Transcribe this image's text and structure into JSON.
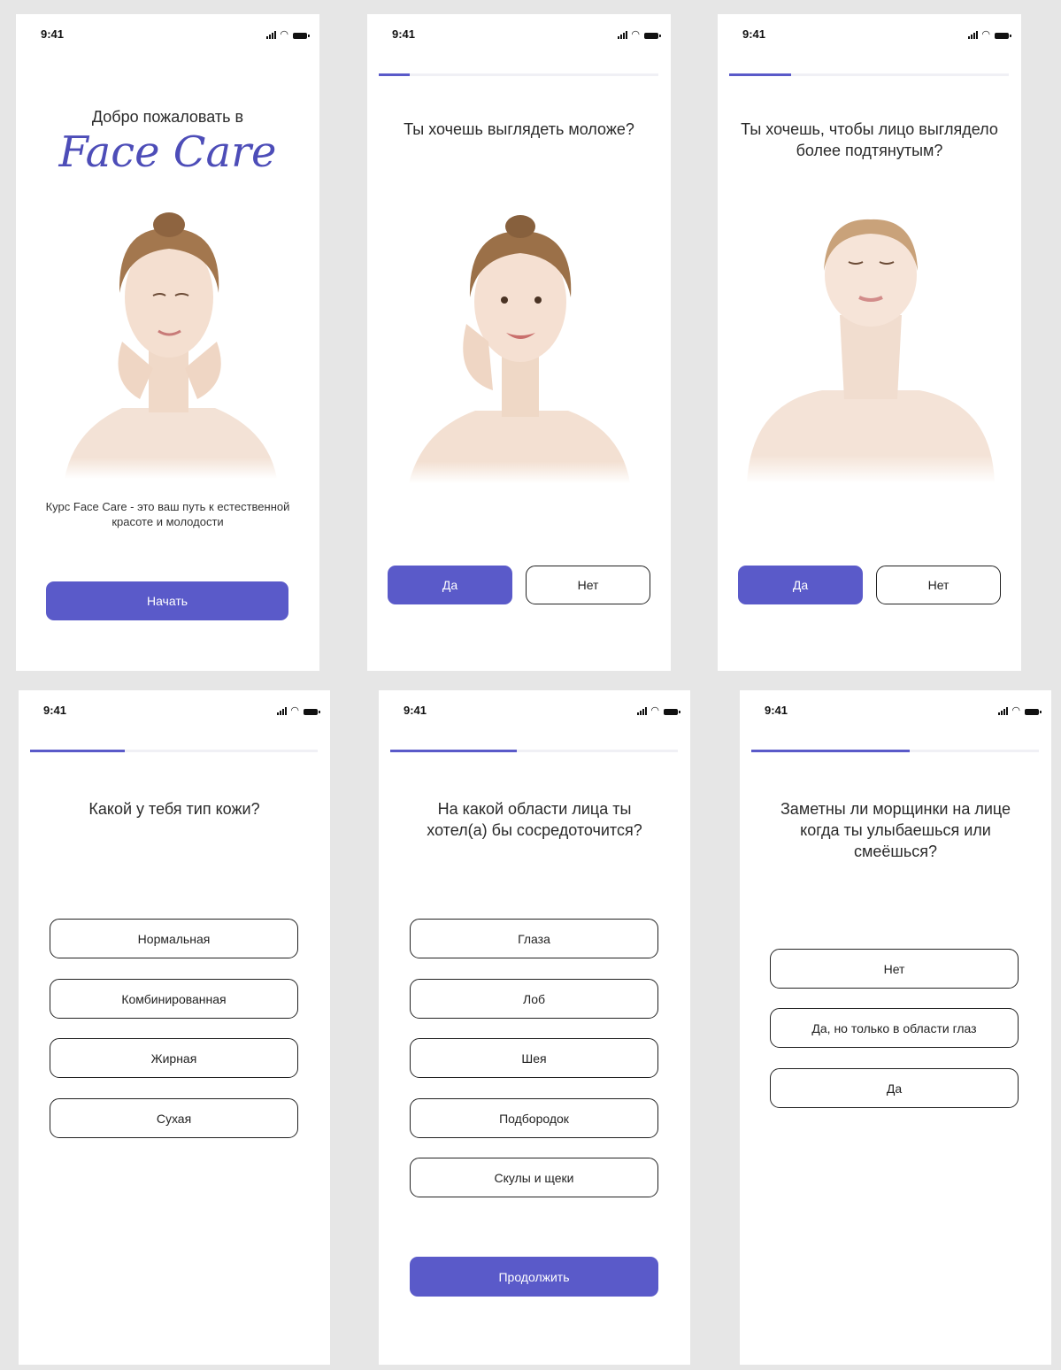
{
  "colors": {
    "accent": "#5a5ac9",
    "brand_text": "#4d4db8",
    "background": "#e6e6e6"
  },
  "status_bar": {
    "time": "9:41"
  },
  "screens": {
    "welcome": {
      "heading": "Добро пожаловать в",
      "brand": "Face Care",
      "description": "Курс Face Care - это ваш путь к естественной красоте и молодости",
      "start_button": "Начать"
    },
    "q_younger": {
      "progress": 0.11,
      "question": "Ты хочешь выглядеть моложе?",
      "yes": "Да",
      "no": "Нет"
    },
    "q_lifted": {
      "progress": 0.22,
      "question": "Ты хочешь, чтобы лицо выглядело более подтянутым?",
      "yes": "Да",
      "no": "Нет"
    },
    "q_skin_type": {
      "progress": 0.33,
      "question": "Какой у тебя тип кожи?",
      "options": [
        "Нормальная",
        "Комбинированная",
        "Жирная",
        "Сухая"
      ]
    },
    "q_focus_area": {
      "progress": 0.44,
      "question": "На какой области лица ты хотел(а) бы сосредоточится?",
      "options": [
        "Глаза",
        "Лоб",
        "Шея",
        "Подбородок",
        "Скулы и щеки"
      ],
      "continue_button": "Продолжить"
    },
    "q_wrinkles": {
      "progress": 0.55,
      "question": "Заметны ли морщинки на лице когда ты улыбаешься или смеёшься?",
      "options": [
        "Нет",
        "Да, но только в области глаз",
        "Да"
      ]
    }
  }
}
